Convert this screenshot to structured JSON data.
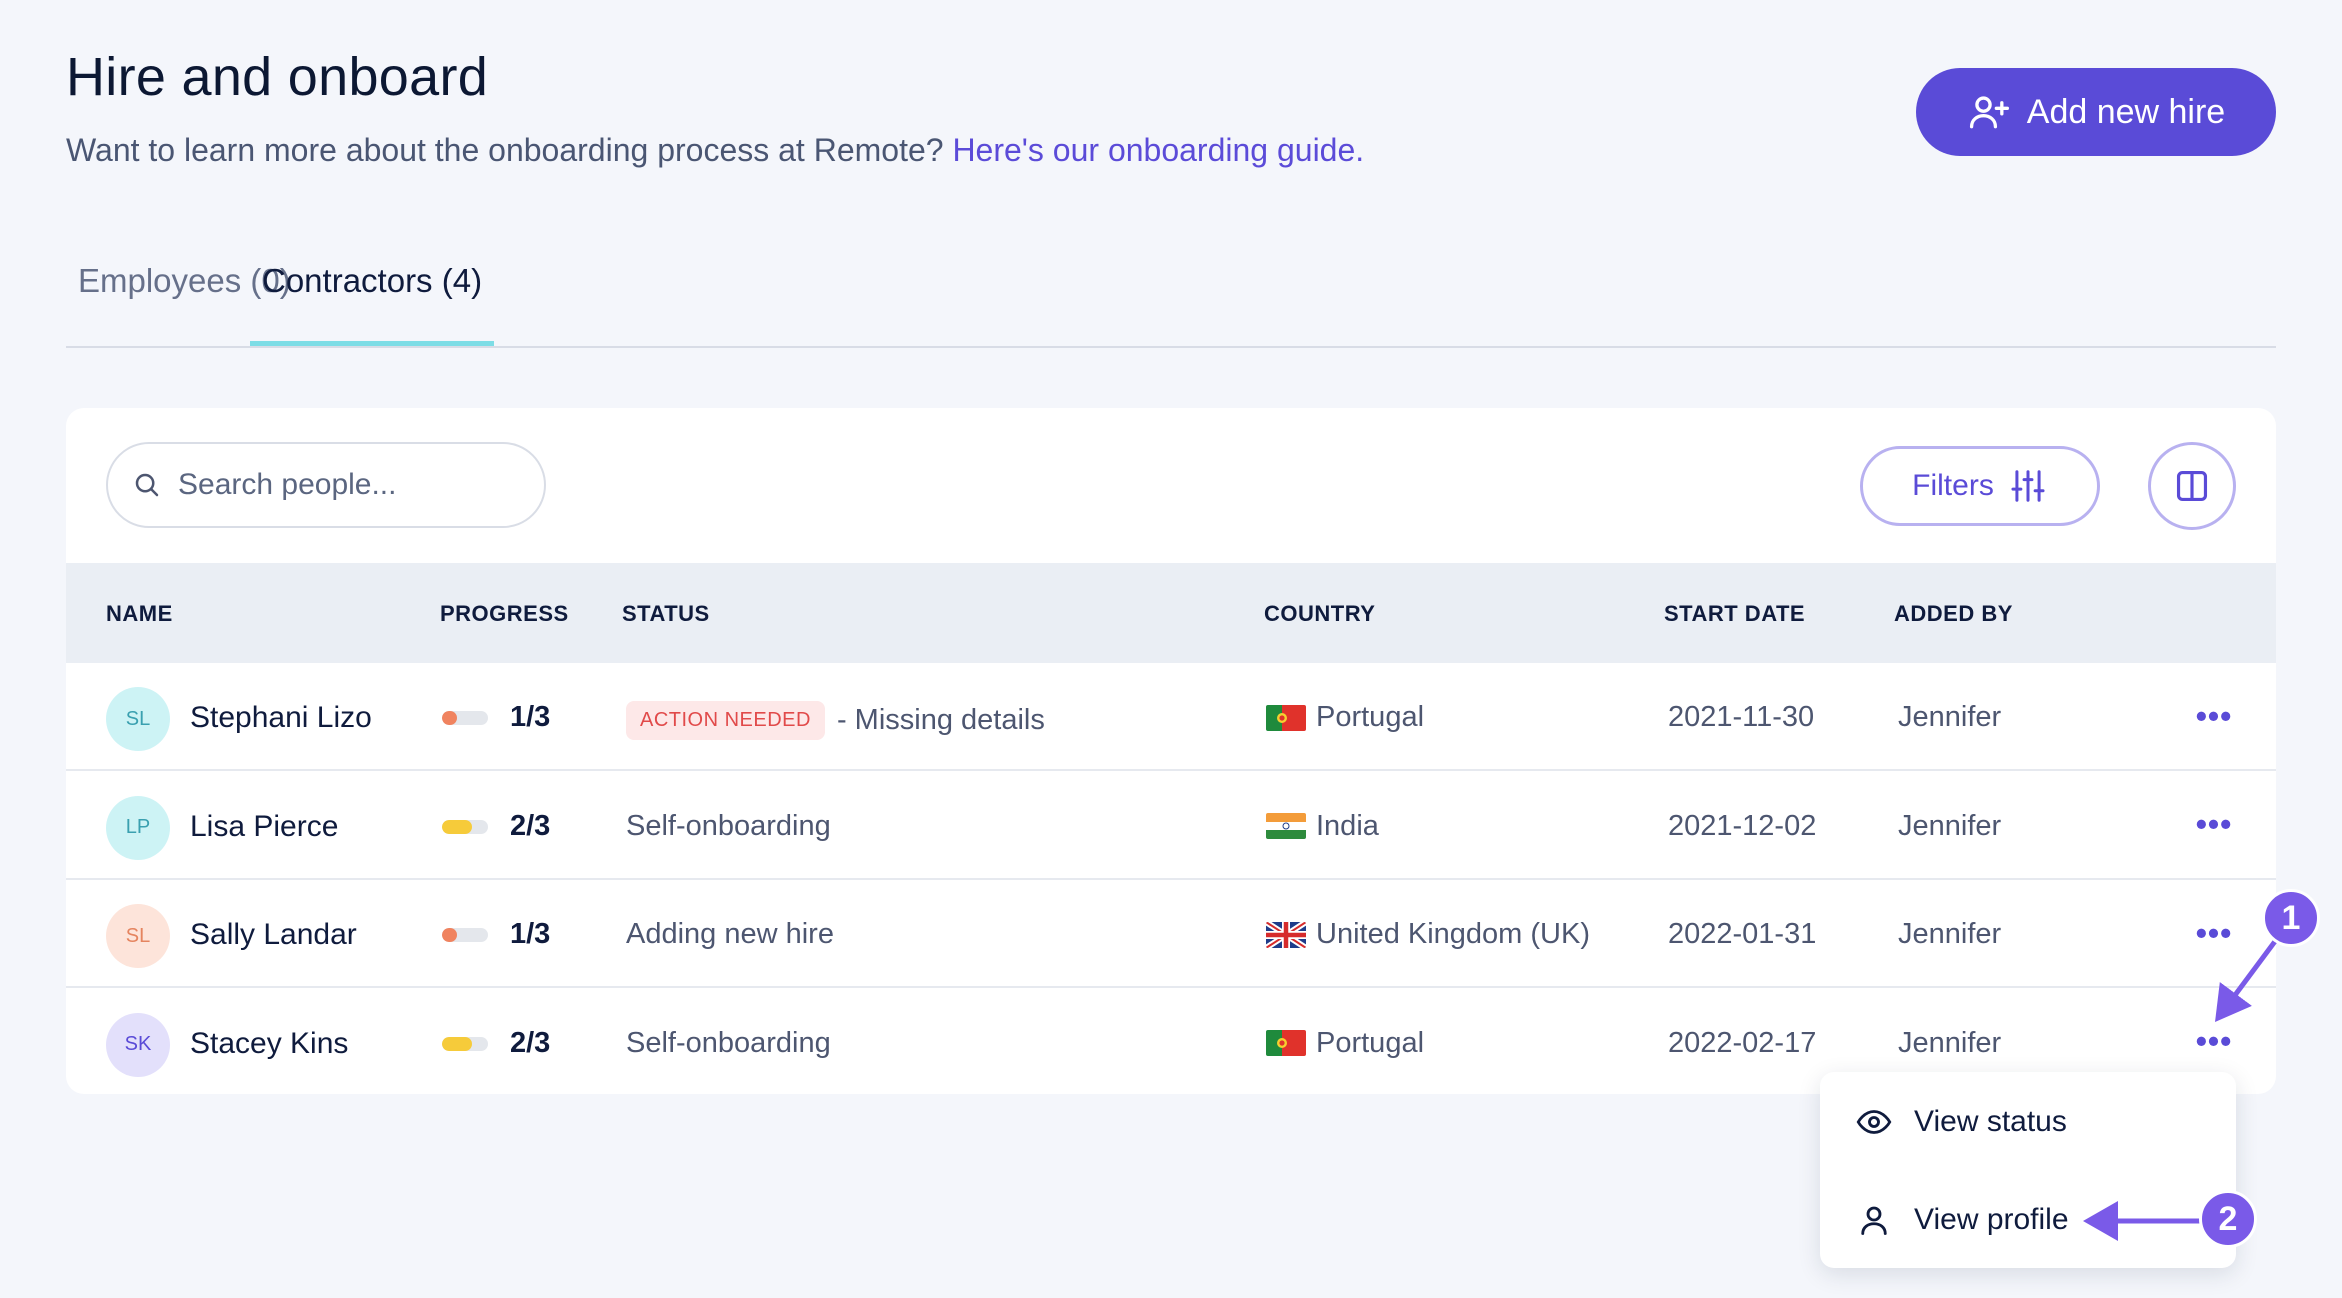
{
  "header": {
    "title": "Hire and onboard",
    "subtitle_text": "Want to learn more about the onboarding process at Remote?",
    "subtitle_link": "Here's our onboarding guide.",
    "add_button_label": "Add new hire"
  },
  "tabs": [
    {
      "label": "Employees (0)",
      "active": false
    },
    {
      "label": "Contractors (4)",
      "active": true
    }
  ],
  "toolbar": {
    "search_placeholder": "Search people...",
    "filters_label": "Filters"
  },
  "table": {
    "columns": [
      "NAME",
      "PROGRESS",
      "STATUS",
      "COUNTRY",
      "START DATE",
      "ADDED BY"
    ],
    "rows": [
      {
        "initials": "SL",
        "name": "Stephani Lizo",
        "progress": "1/3",
        "progress_fraction": 0.33,
        "progress_color": "#f0835f",
        "badge": "ACTION NEEDED",
        "status": "- Missing details",
        "country": "Portugal",
        "flag": "portugal",
        "start_date": "2021-11-30",
        "added_by": "Jennifer",
        "avatar_bg": "#cdf3f5",
        "avatar_fg": "#3aa0b0"
      },
      {
        "initials": "LP",
        "name": "Lisa Pierce",
        "progress": "2/3",
        "progress_fraction": 0.66,
        "progress_color": "#f6cb3a",
        "badge": "",
        "status": "Self-onboarding",
        "country": "India",
        "flag": "india",
        "start_date": "2021-12-02",
        "added_by": "Jennifer",
        "avatar_bg": "#cdf3f5",
        "avatar_fg": "#3aa0b0"
      },
      {
        "initials": "SL",
        "name": "Sally Landar",
        "progress": "1/3",
        "progress_fraction": 0.33,
        "progress_color": "#f0835f",
        "badge": "",
        "status": "Adding new hire",
        "country": "United Kingdom (UK)",
        "flag": "uk",
        "start_date": "2022-01-31",
        "added_by": "Jennifer",
        "avatar_bg": "#fde4da",
        "avatar_fg": "#e5845f"
      },
      {
        "initials": "SK",
        "name": "Stacey Kins",
        "progress": "2/3",
        "progress_fraction": 0.66,
        "progress_color": "#f6cb3a",
        "badge": "",
        "status": "Self-onboarding",
        "country": "Portugal",
        "flag": "portugal",
        "start_date": "2022-02-17",
        "added_by": "Jennifer",
        "avatar_bg": "#e3e0fb",
        "avatar_fg": "#5a4bd7"
      }
    ],
    "more_label": "•••"
  },
  "row_menu": {
    "items": [
      {
        "label": "View status",
        "icon": "eye-icon"
      },
      {
        "label": "View profile",
        "icon": "user-icon"
      }
    ]
  },
  "annotations": {
    "marker_1": "1",
    "marker_2": "2"
  },
  "colors": {
    "accent": "#5a4bd7",
    "tab_underline": "#7ddde6",
    "marker": "#7a5ae8"
  }
}
